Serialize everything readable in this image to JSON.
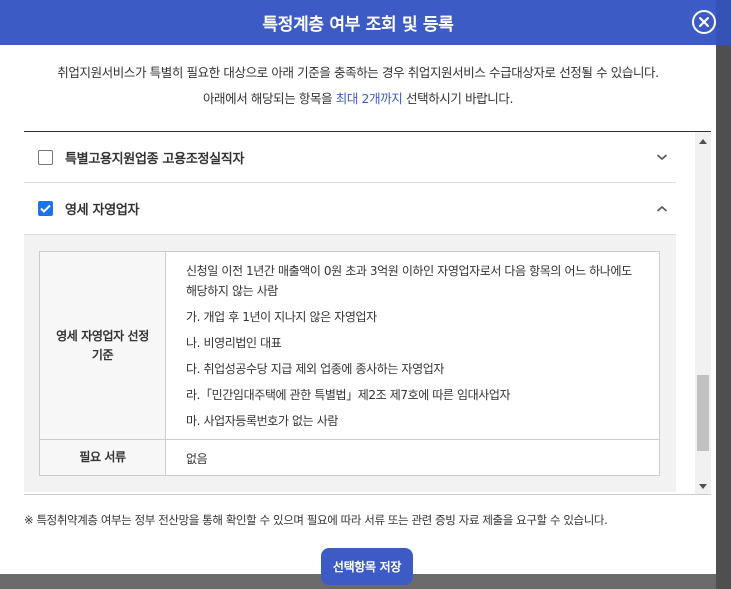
{
  "modal": {
    "title": "특정계층 여부 조회 및 등록"
  },
  "intro": {
    "line1": "취업지원서비스가 특별히 필요한 대상으로 아래 기준을 충족하는 경우 취업지원서비스 수급대상자로 선정될 수 있습니다.",
    "line2_before": "아래에서 해당되는 항목을 ",
    "line2_highlight": "최대 2개까지",
    "line2_after": " 선택하시기 바랍니다."
  },
  "items": [
    {
      "label": "특별고용지원업종 고용조정실직자",
      "checked": false,
      "expanded": false
    },
    {
      "label": "영세 자영업자",
      "checked": true,
      "expanded": true
    }
  ],
  "detail": {
    "criteria_header": "영세 자영업자 선정 기준",
    "criteria_intro": "신청일 이전 1년간 매출액이 0원 초과 3억원 이하인 자영업자로서 다음 항목의 어느 하나에도 해당하지 않는 사람",
    "criteria_items": [
      "가. 개업 후 1년이 지나지 않은 자영업자",
      "나. 비영리법인 대표",
      "다. 취업성공수당 지급 제외 업종에 종사하는 자영업자",
      "라.「민간임대주택에 관한 특별법」제2조 제7호에 따른 임대사업자",
      "마. 사업자등록번호가 없는 사람"
    ],
    "docs_header": "필요 서류",
    "docs_value": "없음"
  },
  "footnote": "※ 특정취약계층 여부는 정부 전산망을 통해 확인할 수 있으며 필요에 따라 서류 또는 관련 증빙 자료 제출을 요구할 수 있습니다.",
  "save_label": "선택항목 저장",
  "colors": {
    "primary": "#3d5bc4",
    "checkbox": "#1a73e8",
    "overlay": "#6b6b6b"
  }
}
